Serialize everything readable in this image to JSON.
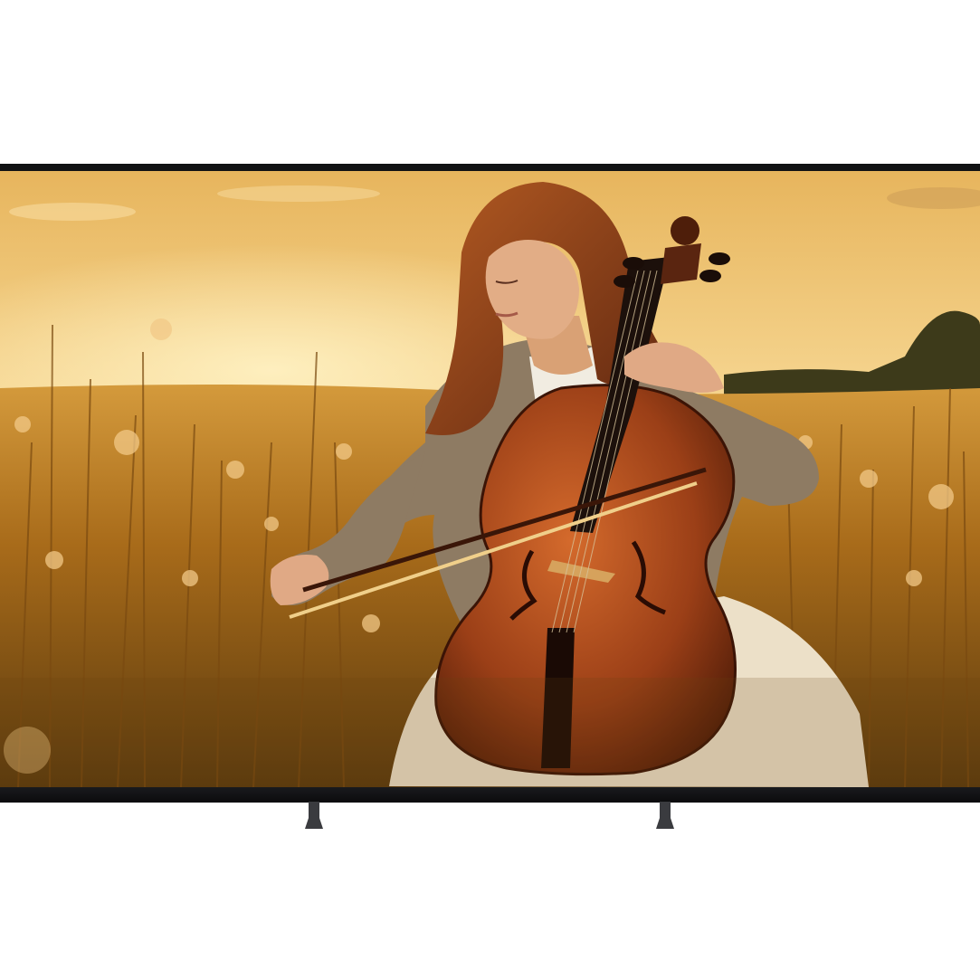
{
  "scene": {
    "device": "flat-panel-tv",
    "screen_content": "cellist-in-golden-field",
    "colors": {
      "bezel": "#111214",
      "sky_top": "#e6b25a",
      "sky_bottom": "#f7d68e",
      "field": "#9a6314",
      "cello_body": "#a5481c",
      "hair": "#8a3d17",
      "jacket": "#8d7a63",
      "stand": "#3a3b3f"
    }
  }
}
